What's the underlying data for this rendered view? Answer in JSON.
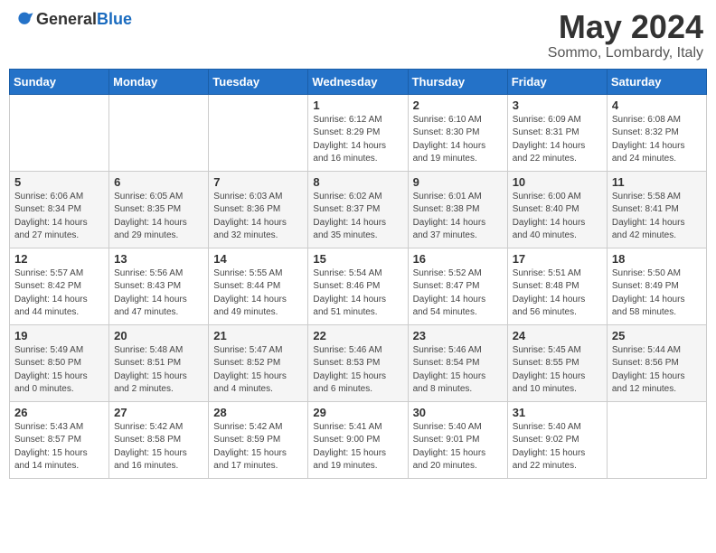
{
  "header": {
    "logo_general": "General",
    "logo_blue": "Blue",
    "month_title": "May 2024",
    "location": "Sommo, Lombardy, Italy"
  },
  "weekdays": [
    "Sunday",
    "Monday",
    "Tuesday",
    "Wednesday",
    "Thursday",
    "Friday",
    "Saturday"
  ],
  "weeks": [
    [
      {
        "day": "",
        "info": ""
      },
      {
        "day": "",
        "info": ""
      },
      {
        "day": "",
        "info": ""
      },
      {
        "day": "1",
        "info": "Sunrise: 6:12 AM\nSunset: 8:29 PM\nDaylight: 14 hours\nand 16 minutes."
      },
      {
        "day": "2",
        "info": "Sunrise: 6:10 AM\nSunset: 8:30 PM\nDaylight: 14 hours\nand 19 minutes."
      },
      {
        "day": "3",
        "info": "Sunrise: 6:09 AM\nSunset: 8:31 PM\nDaylight: 14 hours\nand 22 minutes."
      },
      {
        "day": "4",
        "info": "Sunrise: 6:08 AM\nSunset: 8:32 PM\nDaylight: 14 hours\nand 24 minutes."
      }
    ],
    [
      {
        "day": "5",
        "info": "Sunrise: 6:06 AM\nSunset: 8:34 PM\nDaylight: 14 hours\nand 27 minutes."
      },
      {
        "day": "6",
        "info": "Sunrise: 6:05 AM\nSunset: 8:35 PM\nDaylight: 14 hours\nand 29 minutes."
      },
      {
        "day": "7",
        "info": "Sunrise: 6:03 AM\nSunset: 8:36 PM\nDaylight: 14 hours\nand 32 minutes."
      },
      {
        "day": "8",
        "info": "Sunrise: 6:02 AM\nSunset: 8:37 PM\nDaylight: 14 hours\nand 35 minutes."
      },
      {
        "day": "9",
        "info": "Sunrise: 6:01 AM\nSunset: 8:38 PM\nDaylight: 14 hours\nand 37 minutes."
      },
      {
        "day": "10",
        "info": "Sunrise: 6:00 AM\nSunset: 8:40 PM\nDaylight: 14 hours\nand 40 minutes."
      },
      {
        "day": "11",
        "info": "Sunrise: 5:58 AM\nSunset: 8:41 PM\nDaylight: 14 hours\nand 42 minutes."
      }
    ],
    [
      {
        "day": "12",
        "info": "Sunrise: 5:57 AM\nSunset: 8:42 PM\nDaylight: 14 hours\nand 44 minutes."
      },
      {
        "day": "13",
        "info": "Sunrise: 5:56 AM\nSunset: 8:43 PM\nDaylight: 14 hours\nand 47 minutes."
      },
      {
        "day": "14",
        "info": "Sunrise: 5:55 AM\nSunset: 8:44 PM\nDaylight: 14 hours\nand 49 minutes."
      },
      {
        "day": "15",
        "info": "Sunrise: 5:54 AM\nSunset: 8:46 PM\nDaylight: 14 hours\nand 51 minutes."
      },
      {
        "day": "16",
        "info": "Sunrise: 5:52 AM\nSunset: 8:47 PM\nDaylight: 14 hours\nand 54 minutes."
      },
      {
        "day": "17",
        "info": "Sunrise: 5:51 AM\nSunset: 8:48 PM\nDaylight: 14 hours\nand 56 minutes."
      },
      {
        "day": "18",
        "info": "Sunrise: 5:50 AM\nSunset: 8:49 PM\nDaylight: 14 hours\nand 58 minutes."
      }
    ],
    [
      {
        "day": "19",
        "info": "Sunrise: 5:49 AM\nSunset: 8:50 PM\nDaylight: 15 hours\nand 0 minutes."
      },
      {
        "day": "20",
        "info": "Sunrise: 5:48 AM\nSunset: 8:51 PM\nDaylight: 15 hours\nand 2 minutes."
      },
      {
        "day": "21",
        "info": "Sunrise: 5:47 AM\nSunset: 8:52 PM\nDaylight: 15 hours\nand 4 minutes."
      },
      {
        "day": "22",
        "info": "Sunrise: 5:46 AM\nSunset: 8:53 PM\nDaylight: 15 hours\nand 6 minutes."
      },
      {
        "day": "23",
        "info": "Sunrise: 5:46 AM\nSunset: 8:54 PM\nDaylight: 15 hours\nand 8 minutes."
      },
      {
        "day": "24",
        "info": "Sunrise: 5:45 AM\nSunset: 8:55 PM\nDaylight: 15 hours\nand 10 minutes."
      },
      {
        "day": "25",
        "info": "Sunrise: 5:44 AM\nSunset: 8:56 PM\nDaylight: 15 hours\nand 12 minutes."
      }
    ],
    [
      {
        "day": "26",
        "info": "Sunrise: 5:43 AM\nSunset: 8:57 PM\nDaylight: 15 hours\nand 14 minutes."
      },
      {
        "day": "27",
        "info": "Sunrise: 5:42 AM\nSunset: 8:58 PM\nDaylight: 15 hours\nand 16 minutes."
      },
      {
        "day": "28",
        "info": "Sunrise: 5:42 AM\nSunset: 8:59 PM\nDaylight: 15 hours\nand 17 minutes."
      },
      {
        "day": "29",
        "info": "Sunrise: 5:41 AM\nSunset: 9:00 PM\nDaylight: 15 hours\nand 19 minutes."
      },
      {
        "day": "30",
        "info": "Sunrise: 5:40 AM\nSunset: 9:01 PM\nDaylight: 15 hours\nand 20 minutes."
      },
      {
        "day": "31",
        "info": "Sunrise: 5:40 AM\nSunset: 9:02 PM\nDaylight: 15 hours\nand 22 minutes."
      },
      {
        "day": "",
        "info": ""
      }
    ]
  ]
}
